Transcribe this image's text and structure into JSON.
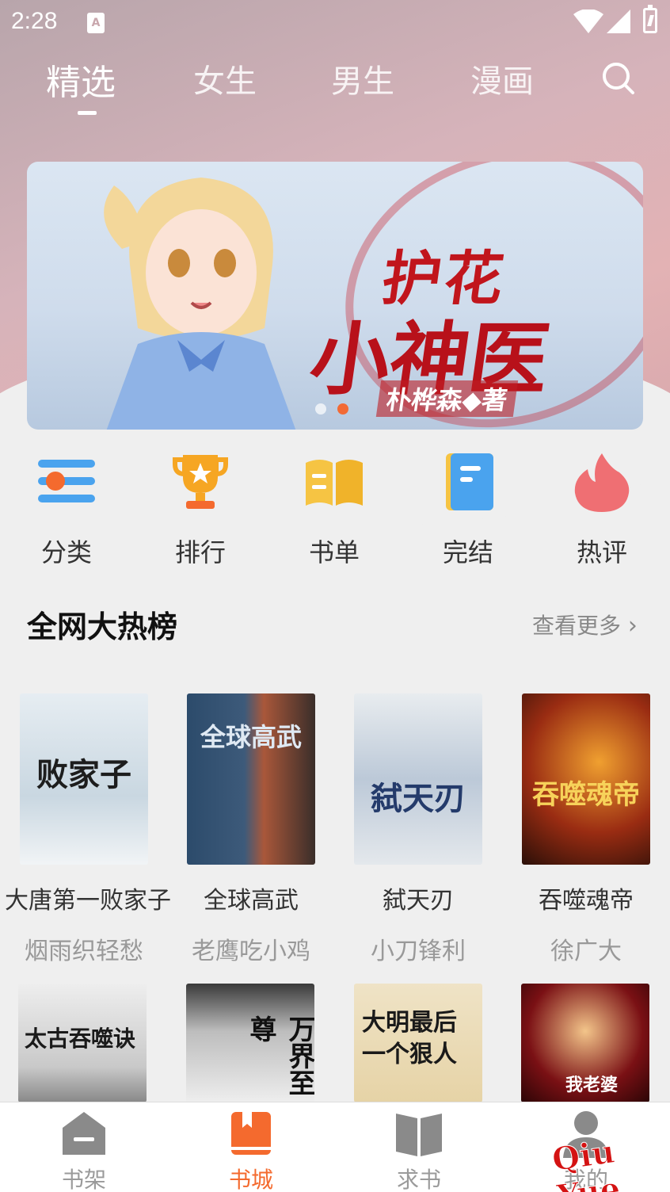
{
  "status_bar": {
    "time": "2:28",
    "app_icon_letter": "A"
  },
  "top_tabs": [
    {
      "label": "精选",
      "active": true
    },
    {
      "label": "女生",
      "active": false
    },
    {
      "label": "男生",
      "active": false
    },
    {
      "label": "漫画",
      "active": false
    }
  ],
  "banner": {
    "title_line1": "护花",
    "title_line2": "小神医",
    "author": "朴桦森◆著",
    "slide_count": 2,
    "active_slide": 2
  },
  "quick_links": [
    {
      "label": "分类",
      "icon": "category-icon"
    },
    {
      "label": "排行",
      "icon": "trophy-icon"
    },
    {
      "label": "书单",
      "icon": "open-book-icon"
    },
    {
      "label": "完结",
      "icon": "finished-book-icon"
    },
    {
      "label": "热评",
      "icon": "flame-icon"
    }
  ],
  "section": {
    "title": "全网大热榜",
    "more": "查看更多"
  },
  "books": [
    {
      "title": "大唐第一败家子",
      "author": "烟雨织轻愁",
      "cover_text": "败家子"
    },
    {
      "title": "全球高武",
      "author": "老鹰吃小鸡",
      "cover_text": "全球高武"
    },
    {
      "title": "弑天刃",
      "author": "小刀锋利",
      "cover_text": "弑天刃"
    },
    {
      "title": "吞噬魂帝",
      "author": "徐广大",
      "cover_text": "吞噬魂帝"
    }
  ],
  "books_row2": [
    {
      "cover_text": "太古吞噬诀"
    },
    {
      "cover_text": "万界至尊"
    },
    {
      "cover_text": "大明最后一个狠人"
    },
    {
      "cover_text": "我老婆"
    }
  ],
  "bottom_nav": [
    {
      "label": "书架",
      "active": false
    },
    {
      "label": "书城",
      "active": true
    },
    {
      "label": "求书",
      "active": false
    },
    {
      "label": "我的",
      "active": false
    }
  ],
  "watermark": "Qiu Yue",
  "colors": {
    "accent": "#f46a2e",
    "inactive": "#9a9a9a"
  }
}
